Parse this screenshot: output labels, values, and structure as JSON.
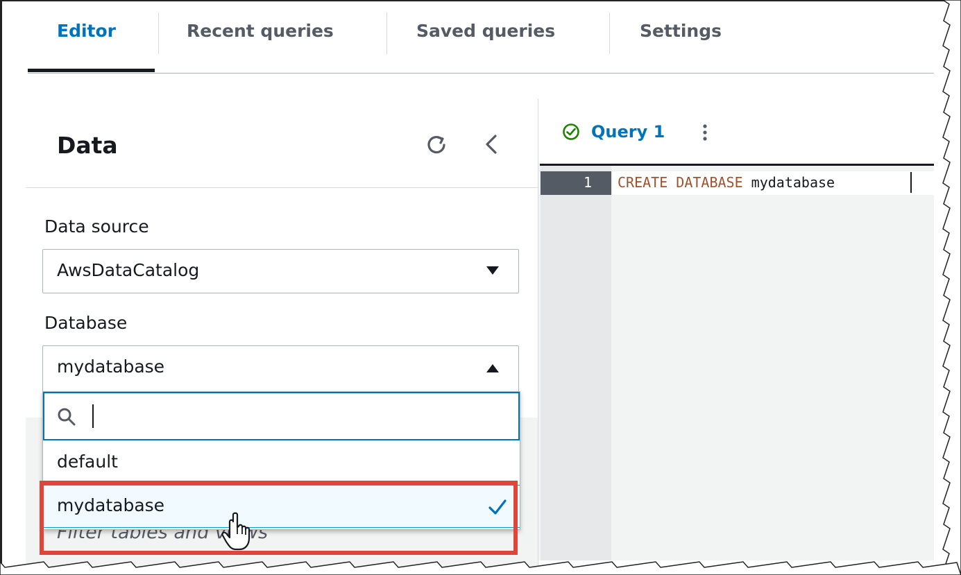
{
  "tabs": [
    {
      "label": "Editor",
      "active": true
    },
    {
      "label": "Recent queries",
      "active": false
    },
    {
      "label": "Saved queries",
      "active": false
    },
    {
      "label": "Settings",
      "active": false
    }
  ],
  "data_panel": {
    "title": "Data",
    "data_source": {
      "label": "Data source",
      "value": "AwsDataCatalog"
    },
    "database": {
      "label": "Database",
      "value": "mydatabase",
      "expanded": true
    },
    "dropdown": {
      "filter_value": "",
      "options": [
        {
          "label": "default",
          "selected": false
        },
        {
          "label": "mydatabase",
          "selected": true
        }
      ]
    },
    "tables_filter_placeholder": "Filter tables and views"
  },
  "editor": {
    "query_tab": {
      "label": "Query 1",
      "status": "success"
    },
    "lines": [
      {
        "number": "1",
        "keywords": "CREATE DATABASE",
        "identifier": "mydatabase"
      }
    ]
  },
  "colors": {
    "accent": "#0073bb",
    "highlight_box": "#e0453a",
    "success": "#1d8102",
    "keyword": "#a0522d"
  },
  "icons": [
    "refresh-icon",
    "collapse-icon",
    "caret-down-icon",
    "caret-up-icon",
    "search-icon",
    "check-icon",
    "success-status-icon",
    "kebab-menu-icon",
    "hand-cursor-icon"
  ]
}
